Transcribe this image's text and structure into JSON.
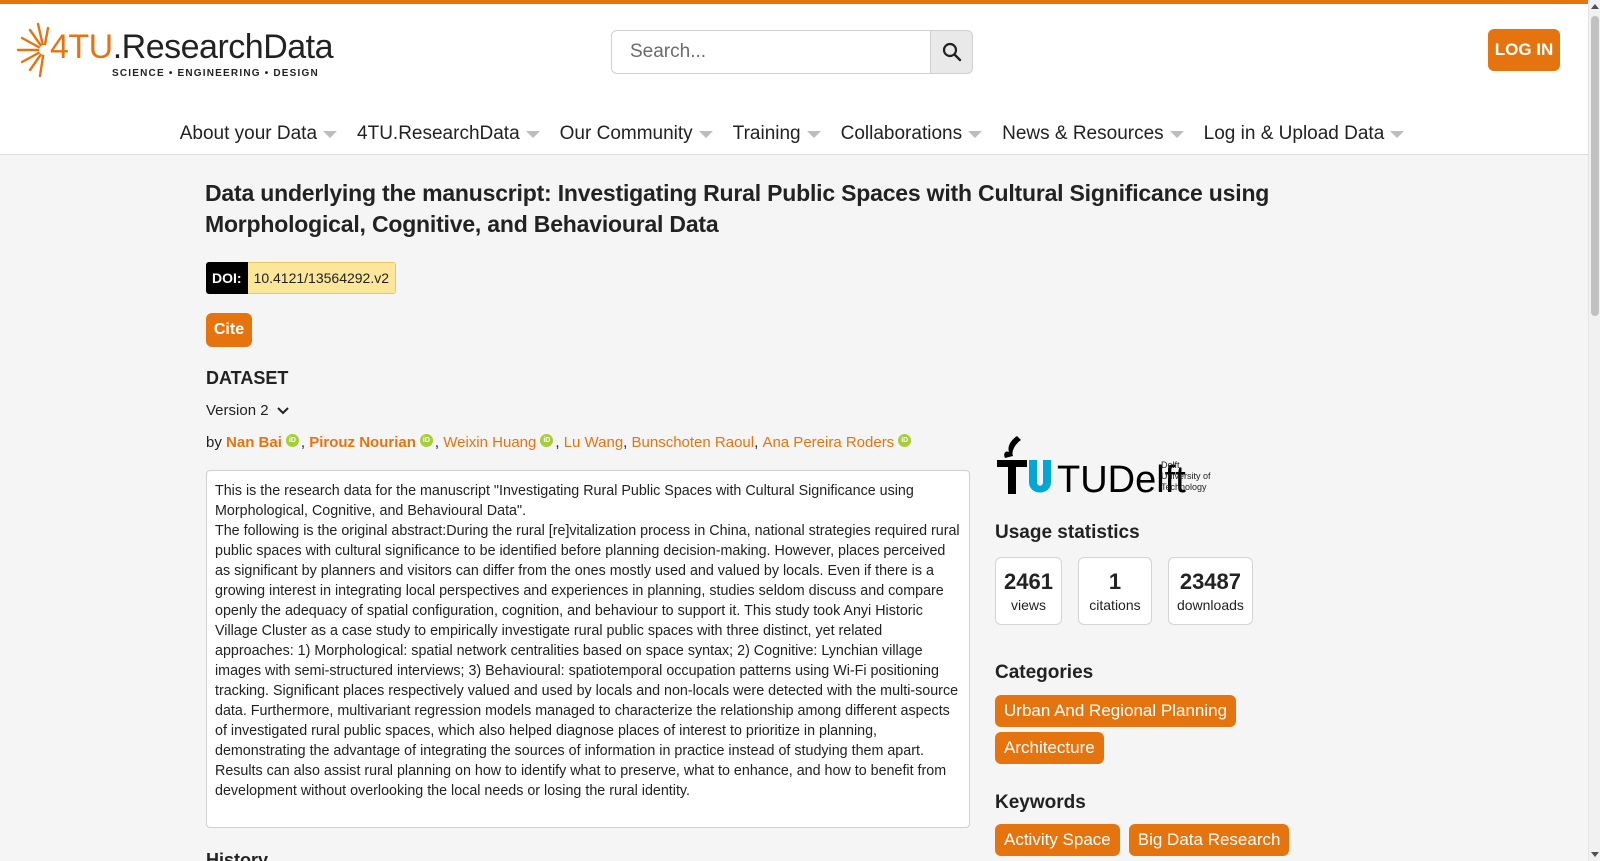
{
  "brand": {
    "name_part1": "4TU",
    "name_part2": ".ResearchData",
    "tagline": "SCIENCE • ENGINEERING • DESIGN",
    "accent": "#e6740e"
  },
  "search": {
    "placeholder": "Search..."
  },
  "header": {
    "login_label": "LOG IN"
  },
  "nav": [
    {
      "label": "About your Data"
    },
    {
      "label": "4TU.ResearchData"
    },
    {
      "label": "Our Community"
    },
    {
      "label": "Training"
    },
    {
      "label": "Collaborations"
    },
    {
      "label": "News & Resources"
    },
    {
      "label": "Log in & Upload Data"
    }
  ],
  "dataset": {
    "title": "Data underlying the manuscript: Investigating Rural Public Spaces with Cultural Significance using Morphological, Cognitive, and Behavioural Data",
    "doi_label": "DOI:",
    "doi_value": "10.4121/13564292.v2",
    "cite_label": "Cite",
    "section_label": "DATASET",
    "version_label": "Version 2",
    "by_label": "by",
    "authors": [
      {
        "name": "Nan Bai"
      },
      {
        "name": "Pirouz Nourian"
      },
      {
        "name": "Weixin Huang"
      },
      {
        "name": "Lu Wang"
      },
      {
        "name": "Bunschoten Raoul"
      },
      {
        "name": "Ana Pereira Roders"
      }
    ],
    "abstract_intro": "This is the research data for the manuscript \"Investigating Rural Public Spaces with Cultural Significance using Morphological, Cognitive, and Behavioural Data\".",
    "abstract_body": "The following is the original abstract:During the rural [re]vitalization process in China, national strategies required rural public spaces with cultural significance to be identified before planning decision-making. However, places perceived as significant by planners and visitors can differ from the ones mostly used and valued by locals. Even if there is a growing interest in integrating local perspectives and experiences in planning, studies seldom discuss and compare openly the adequacy of spatial configuration, cognition, and behaviour to support it. This study took Anyi Historic Village Cluster as a case study to empirically investigate rural public spaces with three distinct, yet related approaches: 1) Morphological: spatial network centralities based on space syntax; 2) Cognitive: Lynchian village images with semi-structured interviews; 3) Behavioural: spatiotemporal occupation patterns using Wi-Fi positioning tracking. Significant places respectively valued and used by locals and non-locals were detected with the multi-source data. Furthermore, multivariant regression models managed to characterize the relationship among different aspects of investigated rural public spaces, which also helped diagnose places of interest to prioritize in planning, demonstrating the advantage of integrating the sources of information in practice instead of studying them apart. Results can also assist rural planning on how to identify what to preserve, what to enhance, and how to benefit from development without overlooking the local needs or losing the rural identity.",
    "history_label": "History"
  },
  "sidebar": {
    "institution": {
      "name": "TUDelft",
      "sub1": "Delft",
      "sub2": "University of",
      "sub3": "Technology"
    },
    "usage_heading": "Usage statistics",
    "stats": [
      {
        "value": "2461",
        "label": "views"
      },
      {
        "value": "1",
        "label": "citations"
      },
      {
        "value": "23487",
        "label": "downloads"
      }
    ],
    "categories_heading": "Categories",
    "categories": [
      {
        "label": "Urban And Regional Planning"
      },
      {
        "label": "Architecture"
      }
    ],
    "keywords_heading": "Keywords",
    "keywords": [
      {
        "label": "Activity Space"
      },
      {
        "label": "Big Data Research"
      }
    ]
  }
}
